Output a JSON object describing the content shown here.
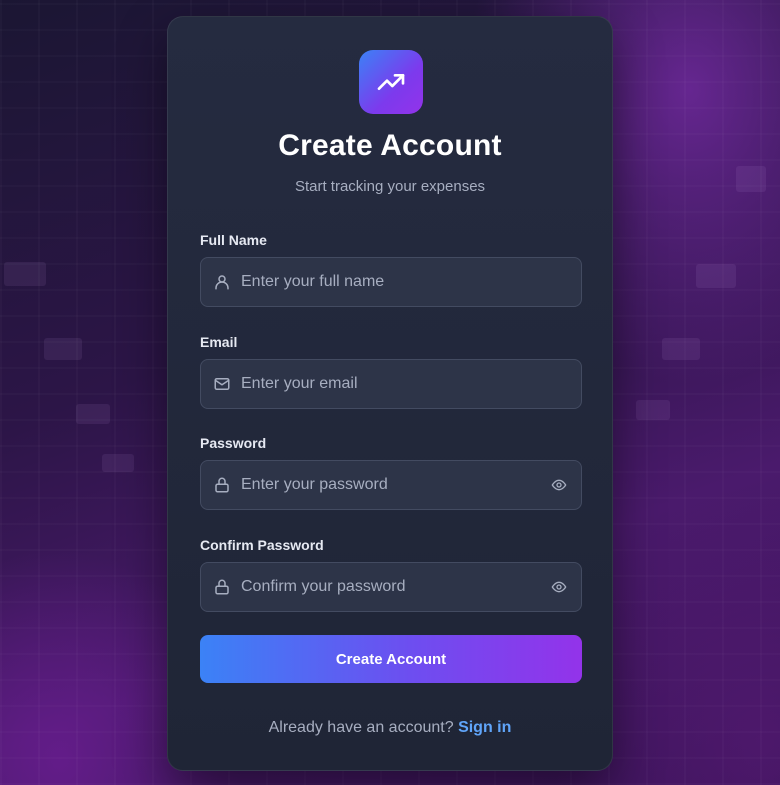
{
  "header": {
    "title": "Create Account",
    "subtitle": "Start tracking your expenses"
  },
  "form": {
    "fields": [
      {
        "label": "Full Name",
        "placeholder": "Enter your full name",
        "value": "",
        "icon": "user-icon"
      },
      {
        "label": "Email",
        "placeholder": "Enter your email",
        "value": "",
        "icon": "mail-icon"
      },
      {
        "label": "Password",
        "placeholder": "Enter your password",
        "value": "",
        "icon": "lock-icon",
        "toggle_icon": "eye-icon"
      },
      {
        "label": "Confirm Password",
        "placeholder": "Confirm your password",
        "value": "",
        "icon": "lock-icon",
        "toggle_icon": "eye-icon"
      }
    ],
    "submit_label": "Create Account"
  },
  "footer": {
    "prompt": "Already have an account?",
    "link": "Sign in"
  },
  "logo": {
    "icon": "trending-up-icon"
  },
  "colors": {
    "accent_start": "#3b82f6",
    "accent_end": "#9333ea",
    "link": "#60a5fa",
    "card": "#232a3c",
    "input_bg": "#2d3448"
  }
}
